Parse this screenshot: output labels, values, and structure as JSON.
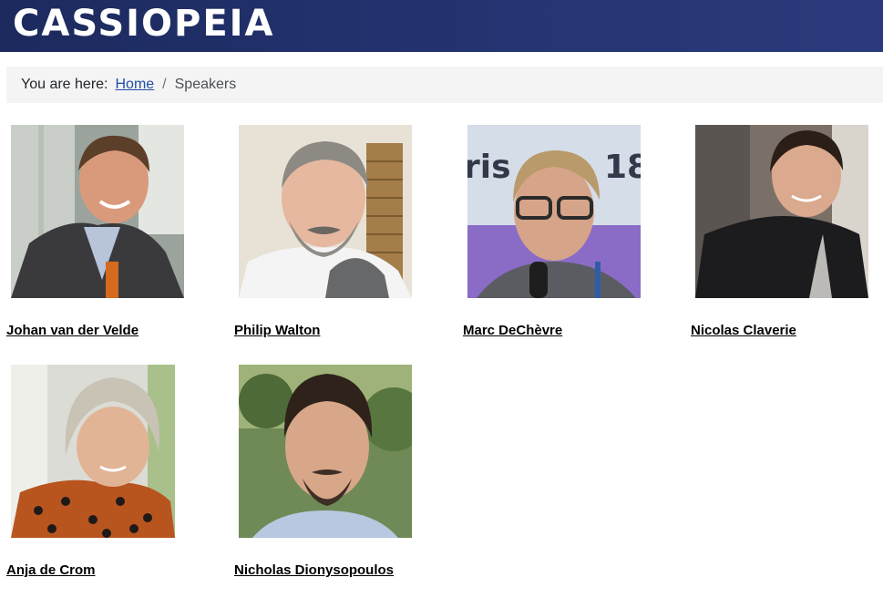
{
  "header": {
    "brand": "CASSIOPEIA"
  },
  "breadcrumb": {
    "label": "You are here:",
    "home": "Home",
    "separator": "/",
    "current": "Speakers"
  },
  "speakers": [
    {
      "name": "Johan van der Velde"
    },
    {
      "name": "Philip Walton"
    },
    {
      "name": "Marc DeChèvre"
    },
    {
      "name": "Nicolas Claverie"
    },
    {
      "name": "Anja de Crom"
    },
    {
      "name": "Nicholas Dionysopoulos"
    }
  ]
}
